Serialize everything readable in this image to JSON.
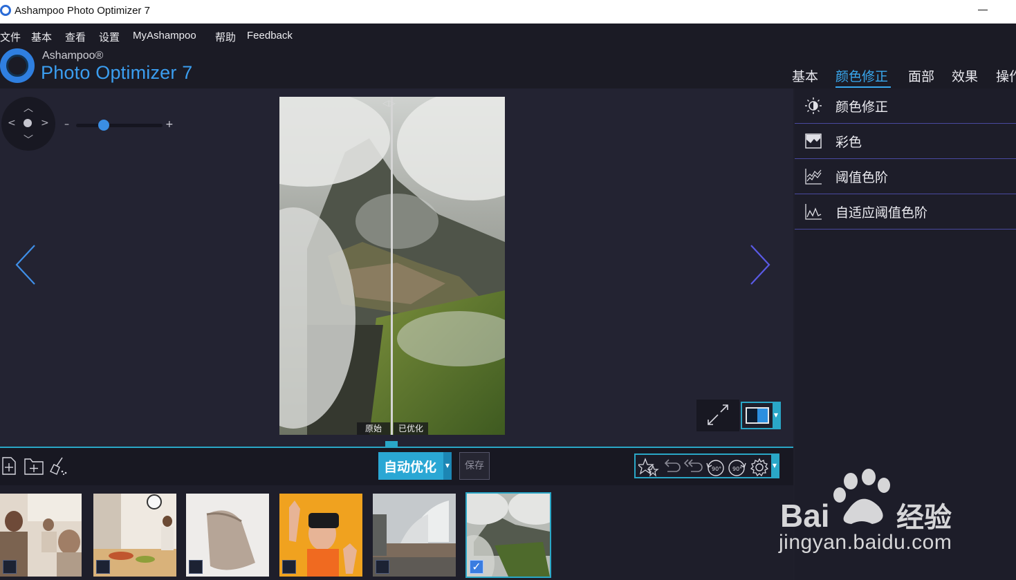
{
  "window": {
    "title": "Ashampoo Photo Optimizer 7"
  },
  "menu": [
    "文件",
    "基本",
    "查看",
    "设置",
    "MyAshampoo",
    "帮助",
    "Feedback"
  ],
  "brand": {
    "company": "Ashampoo®",
    "product": "Photo Optimizer 7"
  },
  "tabs": [
    {
      "label": "基本",
      "active": false
    },
    {
      "label": "颜色修正",
      "active": true
    },
    {
      "label": "面部",
      "active": false
    },
    {
      "label": "效果",
      "active": false
    },
    {
      "label": "操作",
      "active": false
    }
  ],
  "viewer": {
    "zoom_minus": "–",
    "zoom_plus": "+",
    "zoom_level": 0.32,
    "compare_labels": {
      "original": "原始",
      "optimized": "已优化"
    }
  },
  "sidebar": {
    "items": [
      {
        "label": "颜色修正",
        "icon": "brightness-icon"
      },
      {
        "label": "彩色",
        "icon": "color-icon"
      },
      {
        "label": "阈值色阶",
        "icon": "levels-icon"
      },
      {
        "label": "自适应阈值色阶",
        "icon": "adaptive-levels-icon"
      }
    ]
  },
  "toolbar": {
    "auto_optimize": "自动优化",
    "save": "保存",
    "left_icons": [
      "add-file-icon",
      "add-folder-icon",
      "clear-broom-icon"
    ],
    "edit_icons": [
      "favorite-stars-icon",
      "undo-icon",
      "undo-all-icon",
      "rotate-left-90-icon",
      "rotate-right-90-icon",
      "settings-gear-icon"
    ],
    "rotate_label": "90°"
  },
  "filmstrip": {
    "thumbnails": [
      {
        "name": "people-kitchen",
        "checked": false
      },
      {
        "name": "dining-table",
        "checked": false
      },
      {
        "name": "fabric-bag",
        "checked": false
      },
      {
        "name": "vr-headset",
        "checked": false
      },
      {
        "name": "opera-house",
        "checked": false
      },
      {
        "name": "misty-mountain",
        "checked": true
      }
    ],
    "check_mark": "✓"
  },
  "watermark": {
    "text": "jingyan.baidu.com",
    "brand": "Bai du 经验"
  },
  "colors": {
    "accent": "#2aa7c7",
    "tab_active": "#39a9f0",
    "background": "#1f1f2b"
  }
}
